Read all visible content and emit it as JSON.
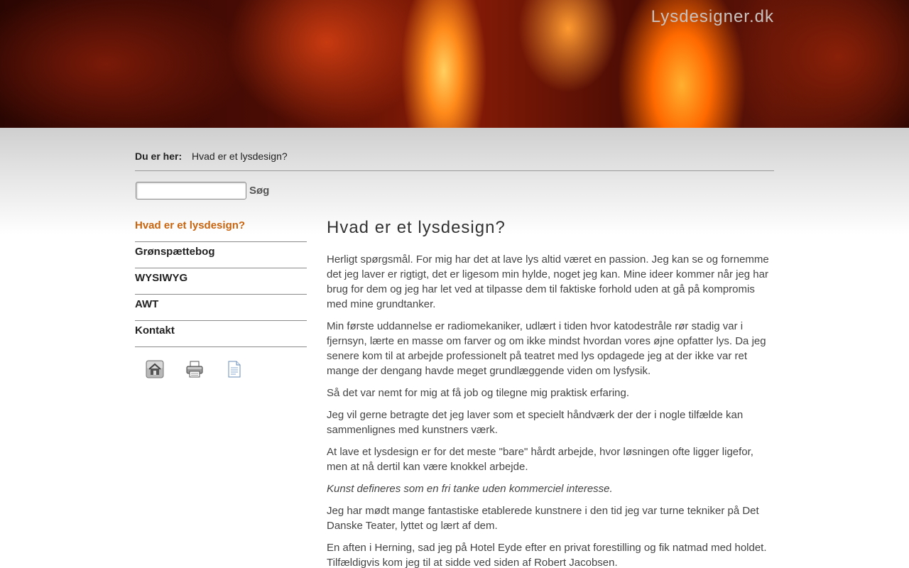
{
  "header": {
    "site_title": "Lysdesigner.dk"
  },
  "breadcrumb": {
    "label": "Du er her:",
    "current": "Hvad er et lysdesign?"
  },
  "search": {
    "placeholder": "",
    "button_label": "Søg"
  },
  "nav": {
    "items": [
      {
        "label": "Hvad er et lysdesign?"
      },
      {
        "label": "Grønspættebog"
      },
      {
        "label": "WYSIWYG"
      },
      {
        "label": "AWT"
      },
      {
        "label": "Kontakt"
      }
    ]
  },
  "tools": {
    "icons": [
      "home-icon",
      "print-icon",
      "document-icon"
    ]
  },
  "colors": {
    "accent": "#c8640e",
    "text": "#333333",
    "divider": "#8a8a8a"
  },
  "content": {
    "title": "Hvad er et lysdesign?",
    "paragraphs": [
      "Herligt spørgsmål. For mig har det at lave lys altid været en passion. Jeg kan se og fornemme det jeg laver er rigtigt, det er ligesom min hylde, noget jeg kan. Mine ideer kommer når jeg har brug for dem og jeg har let ved at tilpasse dem til faktiske forhold uden at gå på kompromis med mine grundtanker.",
      "Min første uddannelse er radiomekaniker, udlært i tiden hvor katodestråle rør stadig var i fjernsyn, lærte en masse om farver og om ikke mindst hvordan vores øjne opfatter lys. Da jeg senere kom til at arbejde professionelt på teatret med lys opdagede jeg at der ikke var ret mange der dengang havde meget grundlæggende viden om lysfysik.",
      "Så det var nemt for mig at få job og tilegne mig praktisk erfaring.",
      "Jeg vil gerne betragte det jeg laver som et specielt håndværk der der i nogle tilfælde kan sammenlignes med kunstners værk.",
      "At lave et lysdesign er for det meste \"bare\" hårdt arbejde, hvor løsningen ofte ligger ligefor, men at nå dertil kan være knokkel arbejde.",
      "Kunst defineres som en fri tanke uden kommerciel interesse.",
      "Jeg har mødt mange fantastiske etablerede kunstnere i den tid jeg var turne tekniker på Det Danske Teater, lyttet og lært af dem.",
      "En aften i Herning, sad jeg på Hotel Eyde efter en privat forestilling og fik natmad med holdet. Tilfældigvis kom jeg til at sidde ved siden af Robert Jacobsen."
    ]
  }
}
